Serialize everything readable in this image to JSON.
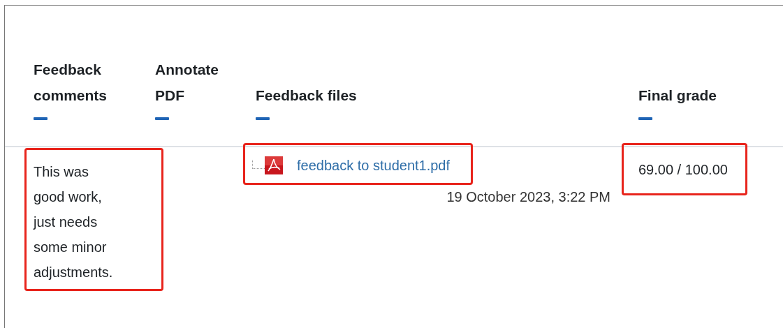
{
  "columns": [
    {
      "label": "Feedback comments"
    },
    {
      "label": "Annotate PDF"
    },
    {
      "label": "Feedback files"
    },
    {
      "label": "Final grade"
    }
  ],
  "row": {
    "feedback_comments": {
      "text": "This was good work, just needs some minor adjustments.",
      "highlighted": true
    },
    "feedback_files": {
      "highlighted": true,
      "files": [
        {
          "name": "feedback to student1.pdf",
          "date": "19 October 2023, 3:22 PM"
        }
      ]
    },
    "final_grade": {
      "text": "69.00 / 100.00",
      "highlighted": true
    }
  }
}
